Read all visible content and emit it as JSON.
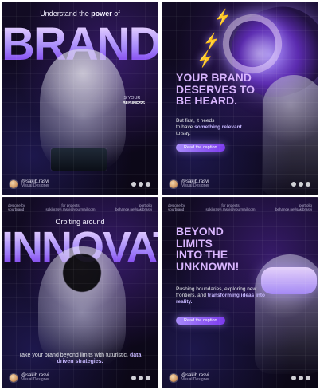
{
  "cards": [
    {
      "top_text_prefix": "Understand the",
      "top_text_bold": "power",
      "top_text_suffix": "of",
      "big_word": "BRANDING",
      "side_text_line1": "IS YOUR",
      "side_text_line2": "BUSINESS",
      "footer": {
        "handle": "@sakib.rasvi",
        "role": "Visual Designer"
      }
    },
    {
      "headline_lines": [
        "YOUR BRAND",
        "DESERVES TO",
        "BE HEARD."
      ],
      "sub_plain_1": "But first, it needs",
      "sub_plain_2": "to have",
      "sub_highlight": "something relevant",
      "sub_plain_3": "to say.",
      "button": "Read the caption",
      "footer": {
        "handle": "@sakib.rasvi",
        "role": "Visual Designer"
      }
    },
    {
      "topbar": {
        "left": "designerby\nyourbrand",
        "center": "for projects\nsakibrasvi.rasvi@yourmail.com",
        "right": "portfolio\nbehance.net/sakibrasvi"
      },
      "top_text": "Orbiting around",
      "big_word": "INNOVATION",
      "bottom_plain": "Take your brand beyond limits with futuristic,",
      "bottom_highlight": "data driven strategies.",
      "footer": {
        "handle": "@sakib.rasvi",
        "role": "Visual Designer"
      }
    },
    {
      "topbar": {
        "left": "designerby\nyourbrand",
        "center": "for projects\nsakibrasvi.rasvi@yourmail.com",
        "right": "portfolio\nbehance.net/sakibrasvi"
      },
      "headline_lines": [
        "BEYOND",
        "LIMITS",
        "INTO THE",
        "UNKNOWN!"
      ],
      "sub_plain": "Pushing boundaries, exploring new frontiers, and",
      "sub_highlight": "transforming ideas into reality.",
      "button": "Read the caption",
      "footer": {
        "handle": "@sakib.rasvi",
        "role": "Visual Designer"
      }
    }
  ]
}
